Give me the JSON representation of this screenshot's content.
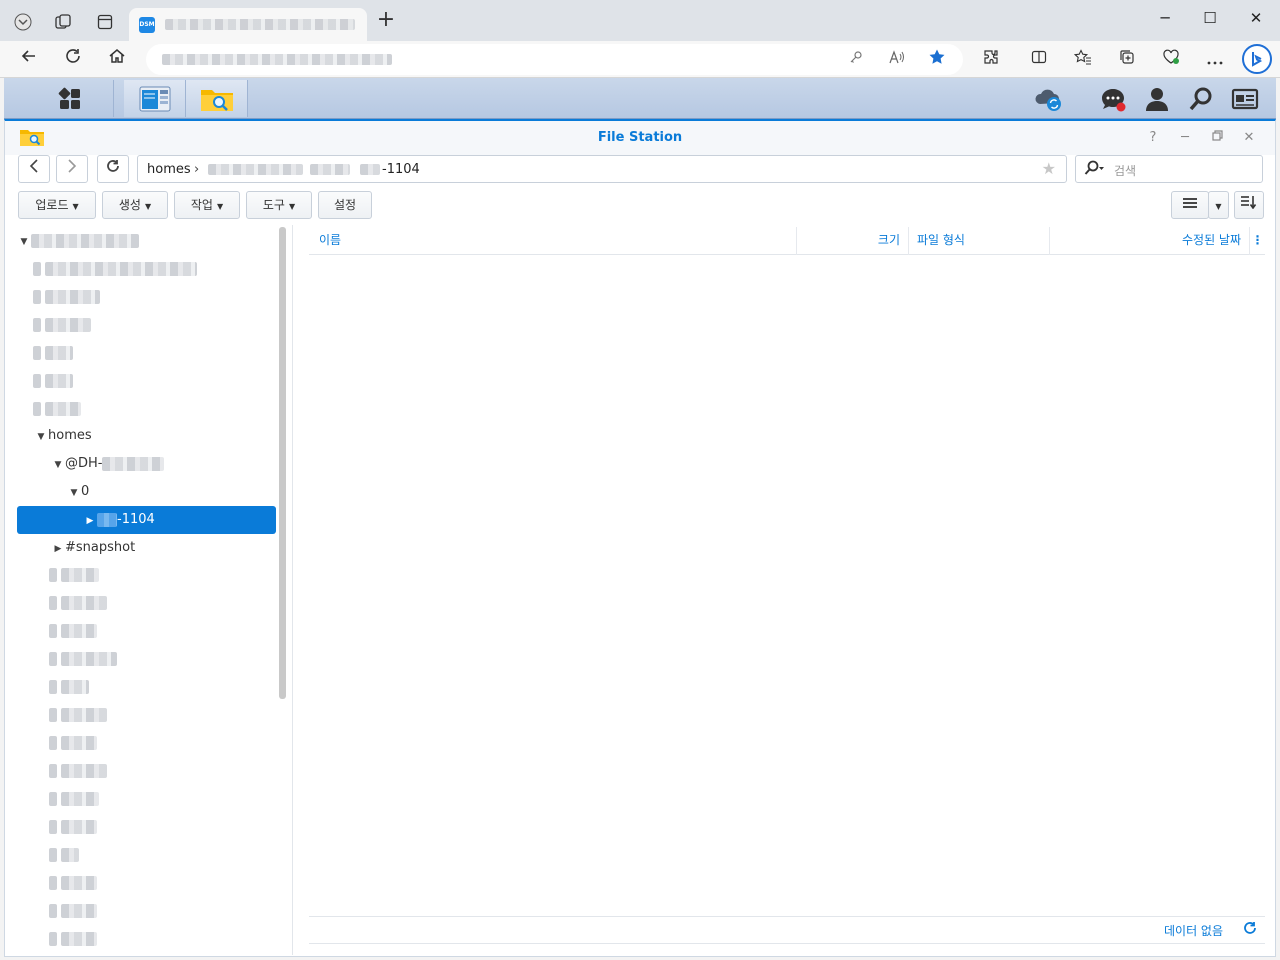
{
  "browser": {
    "tab_title_hidden": true,
    "favicon_label": "DSM",
    "new_tab": "+",
    "controls": {
      "minimize": "─",
      "maximize": "☐",
      "close": "✕"
    }
  },
  "app": {
    "title": "File Station",
    "path": {
      "root": "homes",
      "leaf": "-1104"
    },
    "search_placeholder": "검색",
    "toolbar": {
      "upload": "업로드",
      "create": "생성",
      "action": "작업",
      "tools": "도구",
      "settings": "설정"
    },
    "columns": {
      "name": "이름",
      "size": "크기",
      "type": "파일 형식",
      "modified": "수정된 날짜"
    },
    "empty_message": "데이터 없음",
    "tree": {
      "homes": "homes",
      "dh": "@DH-",
      "zero": "0",
      "selected": "-1104",
      "snapshot": "#snapshot"
    }
  },
  "colors": {
    "accent": "#0a7bd8"
  }
}
